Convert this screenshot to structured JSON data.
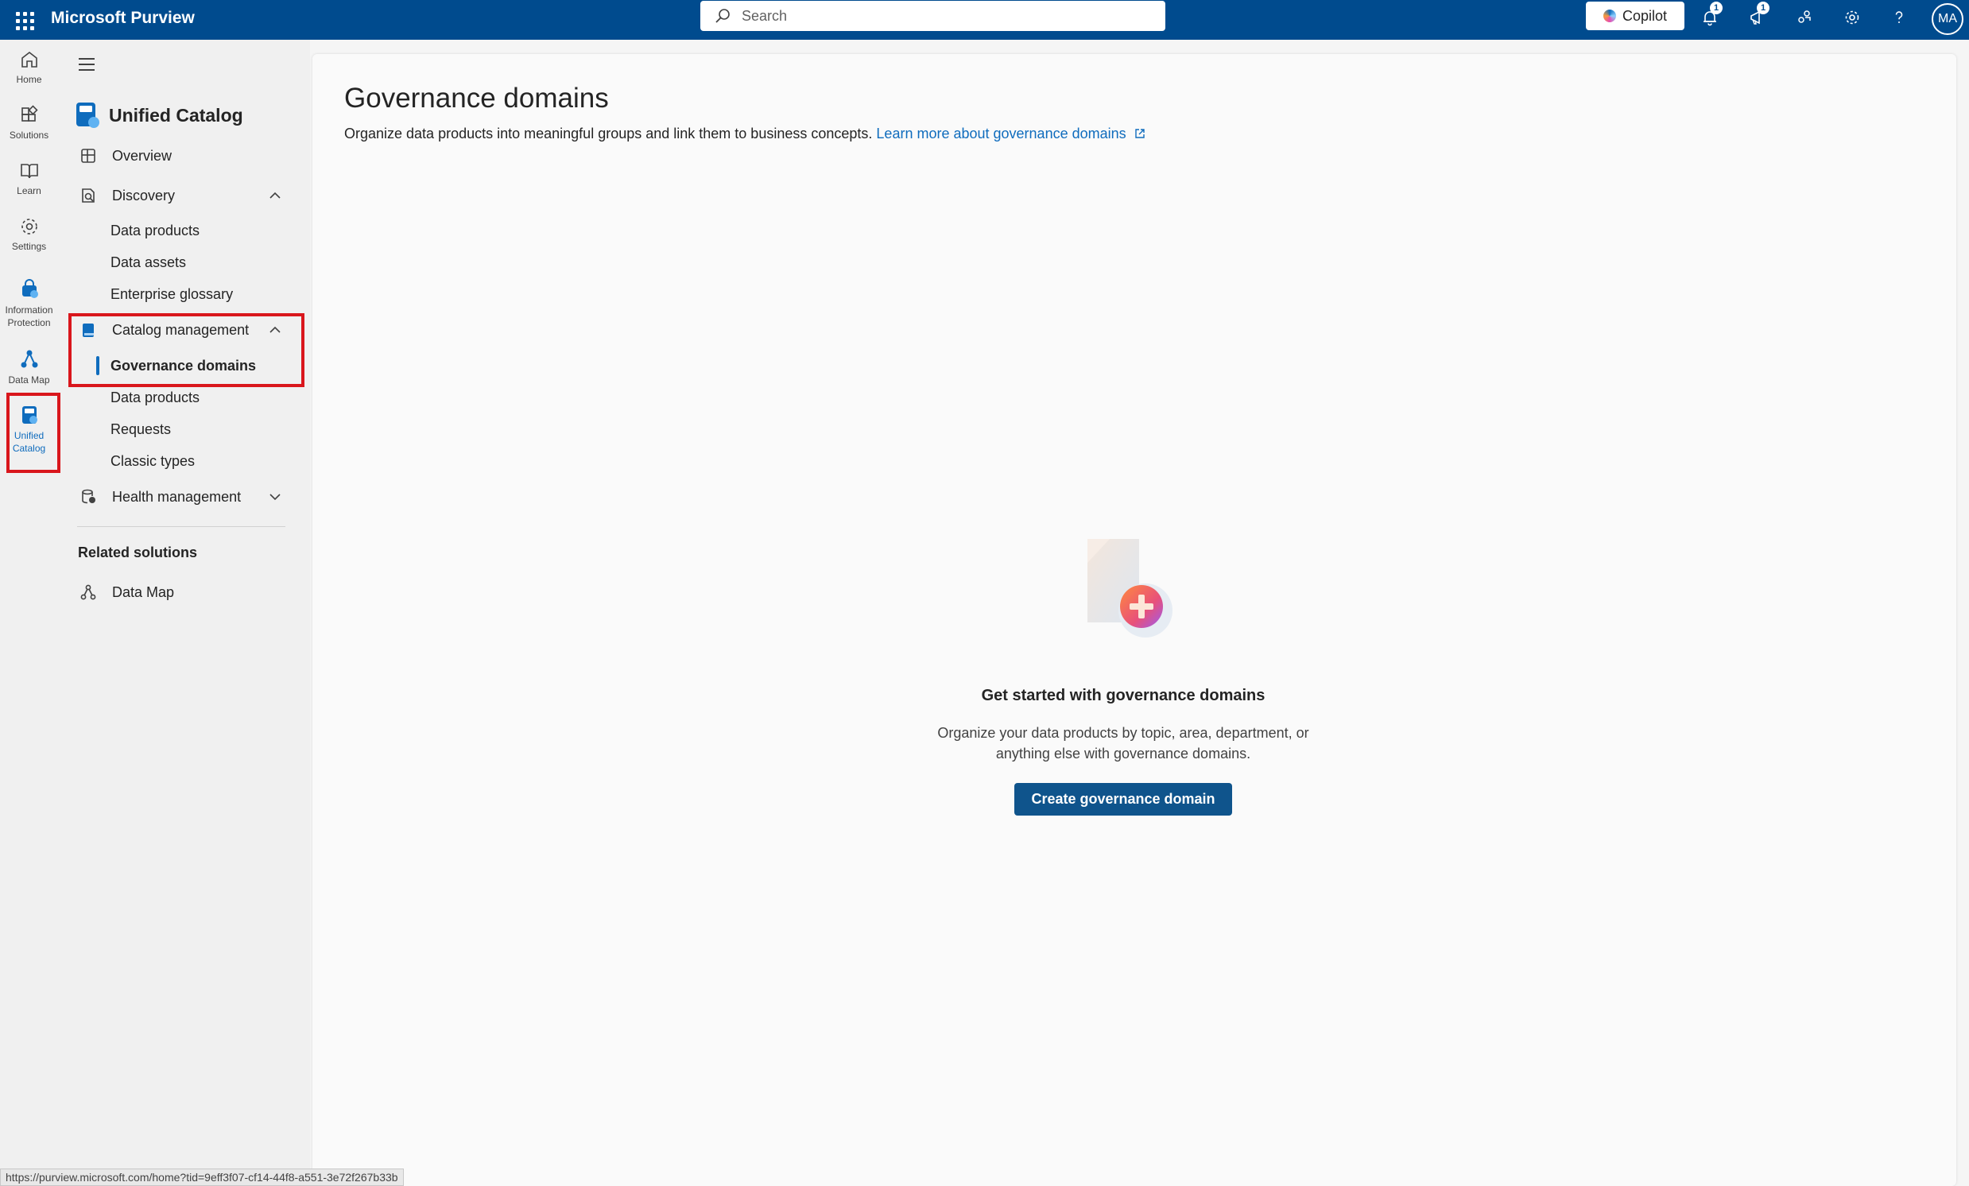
{
  "app": {
    "name": "Microsoft Purview"
  },
  "search": {
    "placeholder": "Search"
  },
  "topbar": {
    "copilot_label": "Copilot",
    "notifications_count": "1",
    "alerts_count": "1",
    "avatar_initials": "MA"
  },
  "rail": {
    "items": [
      {
        "label": "Home",
        "icon": "home-icon"
      },
      {
        "label": "Solutions",
        "icon": "solutions-icon"
      },
      {
        "label": "Learn",
        "icon": "book-icon"
      },
      {
        "label": "Settings",
        "icon": "gear-icon"
      },
      {
        "label": "Information Protection",
        "icon": "information-protection-icon"
      },
      {
        "label": "Data Map",
        "icon": "data-map-icon"
      },
      {
        "label": "Unified Catalog",
        "icon": "unified-catalog-icon"
      }
    ]
  },
  "nav": {
    "title": "Unified Catalog",
    "overview": "Overview",
    "discovery": "Discovery",
    "discovery_items": [
      "Data products",
      "Data assets",
      "Enterprise glossary"
    ],
    "catalog_management": "Catalog management",
    "catalog_items": [
      "Governance domains",
      "Data products",
      "Requests",
      "Classic types"
    ],
    "health_management": "Health management",
    "related_heading": "Related solutions",
    "related_items": [
      "Data Map"
    ]
  },
  "main": {
    "title": "Governance domains",
    "description": "Organize data products into meaningful groups and link them to business concepts.",
    "learn_more": "Learn more about governance domains",
    "empty_title": "Get started with governance domains",
    "empty_desc_line1": "Organize your data products by topic, area, department, or",
    "empty_desc_line2": "anything else with governance domains.",
    "create_button": "Create governance domain"
  },
  "statusbar": {
    "url": "https://purview.microsoft.com/home?tid=9eff3f07-cf14-44f8-a551-3e72f267b33b"
  },
  "colors": {
    "brand": "#004b8e",
    "accent": "#0f6cbd",
    "highlight_box": "#d9161c"
  }
}
